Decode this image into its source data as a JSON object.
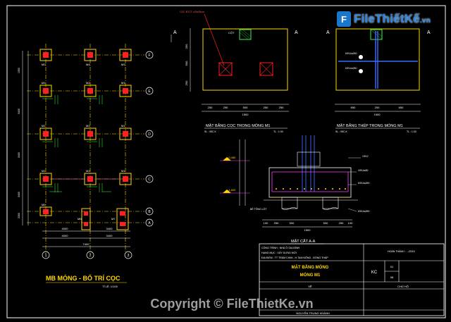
{
  "logo": {
    "icon": "file-icon",
    "text": "FileThiếtKế",
    "domain": ".vn"
  },
  "watermark": "Copyright © FileThietKe.vn",
  "colors": {
    "background": "#000000",
    "frame": "#ffffff",
    "line_yellow": "#ffd800",
    "pile_red": "#ff2020",
    "dim_green": "#3cff3c",
    "axis_cyan": "#3fe0e0",
    "rebar_blue": "#3a6dff",
    "label_magenta": "#ff3cff",
    "cap_green": "#2ecc40"
  },
  "plan": {
    "title": "MB MÓNG - BỐ TRÍ CỌC",
    "scale": "TỈ LỆ: 1/100",
    "grid_letters": [
      "F",
      "E",
      "D",
      "C",
      "B",
      "A"
    ],
    "grid_numbers": [
      "1",
      "2",
      "3"
    ],
    "footing_labels": [
      "M3",
      "M4",
      "M3",
      "M1",
      "M2",
      "M1",
      "M1",
      "M2",
      "M1",
      "M1",
      "M2",
      "M1",
      "M5",
      "M6",
      "M7"
    ],
    "dim_bottom_1": [
      "4000",
      "3400"
    ],
    "dim_bottom_2": [
      "4000",
      "3400"
    ],
    "dim_total": "7400",
    "dim_left": [
      "1300",
      "3400",
      "3400",
      "3400",
      "2300"
    ]
  },
  "pile_plan": {
    "title": "MẶT BẰNG CỌC TRONG MÓNG M1",
    "subtitle_left": "SL : 05C.K",
    "subtitle_right": "TL : 1:30",
    "callout": "CỌC BTCT c25x25cm",
    "column_label": "CỘT",
    "section_mark": "A",
    "dims": [
      "250",
      "250",
      "500",
      "250",
      "250"
    ],
    "dim_total": "1500",
    "dim_side": [
      "250",
      "500",
      "250"
    ]
  },
  "steel_plan": {
    "title": "MẶT BẰNG THÉP TRONG MÓNG M1",
    "subtitle_left": "SL : 05C.K",
    "subtitle_right": "TL : 1:30",
    "section_mark": "A",
    "dims": [
      "650",
      "200",
      "650"
    ],
    "dim_total": "1500",
    "rebar_labels": [
      "6Φ14a250",
      "6Φ14a250"
    ]
  },
  "section": {
    "title": "MẶT CẮT A-A",
    "levels": [
      "-0,450",
      "-1,600"
    ],
    "rebar_labels": [
      "1Φ12",
      "4Φ14a50",
      "6Φ14a250",
      "6Φ14a250"
    ],
    "base_label": "BÊ TÔNG LÓT",
    "dims": [
      "100",
      "250",
      "500",
      "500",
      "250",
      "100"
    ],
    "dim_total": "1500"
  },
  "title_block": {
    "project": "CÔNG TRÌNH : NHÀ Ở GIA ĐÌNH",
    "item": "HẠNG MỤC : XÂY DỰNG MỚI",
    "location": "ĐỊA ĐIỂM : TT TRÀM CHIM - H.TAM NÔNG - ĐỒNG THÁP",
    "date": "HOÀN THÀNH : .../2015",
    "drawing_title_1": "MẶT BẰNG MÓNG",
    "drawing_title_2": "MÓNG M1",
    "code": "KC",
    "sheet_no": "01",
    "sheet_total": "08",
    "drawn_label": "VẼ",
    "checked_label": "CHỦ HỘ",
    "drawer_name": "NGUYỄN TRUNG KHÁNH"
  }
}
